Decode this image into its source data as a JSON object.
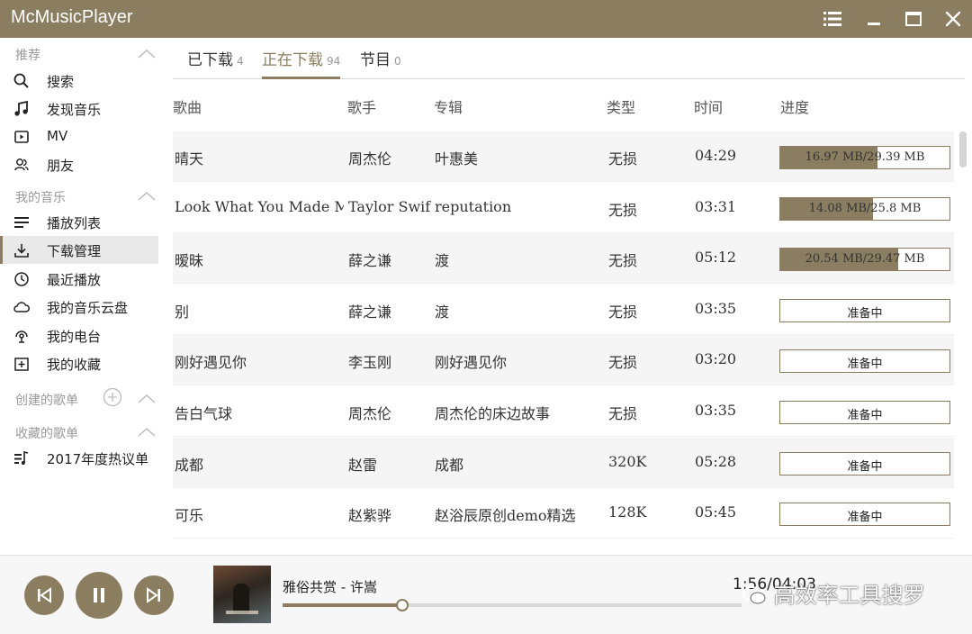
{
  "app": {
    "title": "McMusicPlayer"
  },
  "window": {
    "menu_icon": "list-menu-icon",
    "minimize_icon": "minimize-icon",
    "maximize_icon": "maximize-icon",
    "close_icon": "close-icon"
  },
  "theme": {
    "accent": "#8b7d5f",
    "titlebar_bg": "#8b7d5f",
    "row_shade": "#f5f5f5"
  },
  "sidebar": {
    "sections": [
      {
        "label": "推荐",
        "items": [
          {
            "label": "搜索",
            "icon": "search-icon"
          },
          {
            "label": "发现音乐",
            "icon": "music-note-icon"
          },
          {
            "label": "MV",
            "icon": "video-icon"
          },
          {
            "label": "朋友",
            "icon": "friends-icon"
          }
        ]
      },
      {
        "label": "我的音乐",
        "items": [
          {
            "label": "播放列表",
            "icon": "playlist-icon"
          },
          {
            "label": "下载管理",
            "icon": "download-icon",
            "active": true
          },
          {
            "label": "最近播放",
            "icon": "clock-icon"
          },
          {
            "label": "我的音乐云盘",
            "icon": "cloud-icon"
          },
          {
            "label": "我的电台",
            "icon": "radio-icon"
          },
          {
            "label": "我的收藏",
            "icon": "collection-icon"
          }
        ]
      },
      {
        "label": "创建的歌单",
        "items": []
      },
      {
        "label": "收藏的歌单",
        "items": [
          {
            "label": "2017年度热议单",
            "icon": "playlist-music-icon"
          }
        ]
      }
    ]
  },
  "tabs": [
    {
      "label": "已下载",
      "count": "4"
    },
    {
      "label": "正在下载",
      "count": "94",
      "active": true
    },
    {
      "label": "节目",
      "count": "0"
    }
  ],
  "columns": {
    "song": "歌曲",
    "artist": "歌手",
    "album": "专辑",
    "type": "类型",
    "time": "时间",
    "progress": "进度"
  },
  "rows": [
    {
      "song": "晴天",
      "artist": "周杰伦",
      "album": "叶惠美",
      "type": "无损",
      "time": "04:29",
      "progress_text": "16.97 MB/29.39 MB",
      "progress": 0.577
    },
    {
      "song": "Look What You Made Me",
      "artist": "Taylor Swift",
      "album": "reputation",
      "type": "无损",
      "time": "03:31",
      "progress_text": "14.08 MB/25.8 MB",
      "progress": 0.546
    },
    {
      "song": "暧昧",
      "artist": "薛之谦",
      "album": "渡",
      "type": "无损",
      "time": "05:12",
      "progress_text": "20.54 MB/29.47 MB",
      "progress": 0.697
    },
    {
      "song": "别",
      "artist": "薛之谦",
      "album": "渡",
      "type": "无损",
      "time": "03:35",
      "progress_text": "准备中",
      "progress": 0
    },
    {
      "song": "刚好遇见你",
      "artist": "李玉刚",
      "album": "刚好遇见你",
      "type": "无损",
      "time": "03:20",
      "progress_text": "准备中",
      "progress": 0
    },
    {
      "song": "告白气球",
      "artist": "周杰伦",
      "album": "周杰伦的床边故事",
      "type": "无损",
      "time": "03:35",
      "progress_text": "准备中",
      "progress": 0
    },
    {
      "song": "成都",
      "artist": "赵雷",
      "album": "成都",
      "type": "320K",
      "time": "05:28",
      "progress_text": "准备中",
      "progress": 0
    },
    {
      "song": "可乐",
      "artist": "赵紫骅",
      "album": "赵浴辰原创demo精选",
      "type": "128K",
      "time": "05:45",
      "progress_text": "准备中",
      "progress": 0
    }
  ],
  "player": {
    "now_playing": "雅俗共赏 - 许嵩",
    "time_readout": "1:56/04:03",
    "seek_progress": 0.26,
    "prev_icon": "skip-previous-icon",
    "pause_icon": "pause-icon",
    "next_icon": "skip-next-icon"
  },
  "watermark": {
    "text": "高效率工具搜罗"
  }
}
